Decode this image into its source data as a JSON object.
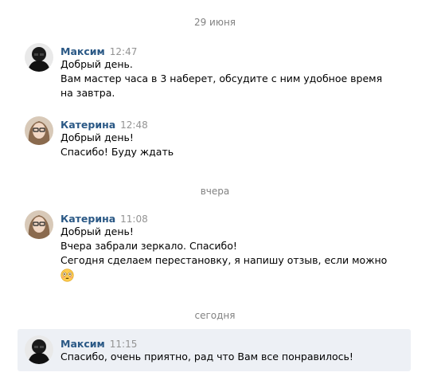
{
  "dividers": {
    "d1": "29 июня",
    "d2": "вчера",
    "d3": "сегодня"
  },
  "messages": [
    {
      "author": "Максим",
      "time": "12:47",
      "lines": [
        "Добрый день.",
        "Вам мастер часа в 3 наберет, обсудите с ним удобное время",
        "на завтра."
      ]
    },
    {
      "author": "Катерина",
      "time": "12:48",
      "lines": [
        "Добрый день!",
        "Спасибо! Буду ждать"
      ]
    },
    {
      "author": "Катерина",
      "time": "11:08",
      "lines": [
        "Добрый день!",
        "Вчера забрали зеркало. Спасибо!",
        "Сегодня сделаем перестановку, я напишу отзыв, если можно"
      ],
      "emoji": "flushed-face-emoji"
    },
    {
      "author": "Максим",
      "time": "11:15",
      "lines": [
        "Спасибо, очень приятно, рад что Вам все понравилось!"
      ],
      "highlighted": true
    }
  ],
  "colors": {
    "author": "#2a5885",
    "time": "#939393",
    "divider": "#828282",
    "highlight_bg": "#edf0f5"
  }
}
